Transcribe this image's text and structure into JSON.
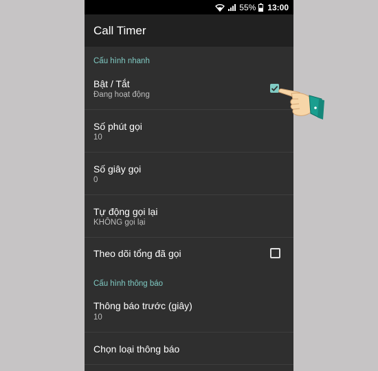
{
  "status": {
    "battery": "55%",
    "time": "13:00"
  },
  "app": {
    "title": "Call Timer"
  },
  "sections": [
    {
      "header": "Cấu hình nhanh"
    },
    {
      "header": "Cấu hình thông báo"
    }
  ],
  "prefs": {
    "toggle": {
      "title": "Bật / Tắt",
      "summary": "Đang hoạt động",
      "checked": true
    },
    "minutes": {
      "title": "Số phút gọi",
      "summary": "10"
    },
    "seconds": {
      "title": "Số giây gọi",
      "summary": "0"
    },
    "redial": {
      "title": "Tự động gọi lại",
      "summary": "KHÔNG gọi lại"
    },
    "track": {
      "title": "Theo dõi tổng đã gọi",
      "checked": false
    },
    "notify_before": {
      "title": "Thông báo trước (giây)",
      "summary": "10"
    },
    "notify_type": {
      "title": "Chọn loại thông báo"
    }
  },
  "colors": {
    "accent": "#80cbc4",
    "background": "#2f2f2f",
    "appbar": "#212121"
  },
  "icons": [
    "wifi-icon",
    "signal-icon",
    "battery-icon",
    "checkbox-checked-icon",
    "checkbox-empty-icon",
    "pointing-hand-icon"
  ]
}
